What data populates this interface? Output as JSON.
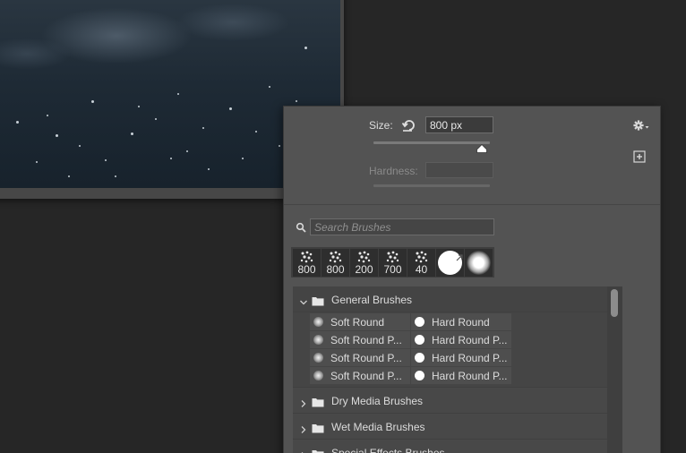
{
  "brush_options": {
    "size_label": "Size:",
    "size_value": "800 px",
    "size_level": 0.93,
    "hardness_label": "Hardness:",
    "hardness_value": "",
    "popup_tab_glyph": "›"
  },
  "search": {
    "placeholder": "Search Brushes",
    "value": ""
  },
  "recent_brushes": [
    {
      "size": "800",
      "kind": "textured"
    },
    {
      "size": "800",
      "kind": "textured"
    },
    {
      "size": "200",
      "kind": "textured"
    },
    {
      "size": "700",
      "kind": "textured"
    },
    {
      "size": "40",
      "kind": "textured"
    },
    {
      "size": "",
      "kind": "hard-round-selected"
    },
    {
      "size": "",
      "kind": "soft-round"
    }
  ],
  "folders": [
    {
      "name": "General Brushes",
      "expanded": true,
      "presets": [
        [
          "Soft Round",
          "Hard Round"
        ],
        [
          "Soft Round P...",
          "Hard Round P..."
        ],
        [
          "Soft Round P...",
          "Hard Round P..."
        ],
        [
          "Soft Round P...",
          "Hard Round P..."
        ]
      ]
    },
    {
      "name": "Dry Media Brushes",
      "expanded": false
    },
    {
      "name": "Wet Media Brushes",
      "expanded": false
    },
    {
      "name": "Special Effects Brushes",
      "expanded": false
    }
  ],
  "icons": {
    "settings": "gear-icon",
    "new_preset": "new-preset-icon",
    "reset_size": "reset-icon",
    "search": "search-icon",
    "folder": "folder-icon"
  },
  "colors": {
    "panel_bg": "#535353",
    "workspace_bg": "#262626",
    "list_bg": "#454545"
  }
}
